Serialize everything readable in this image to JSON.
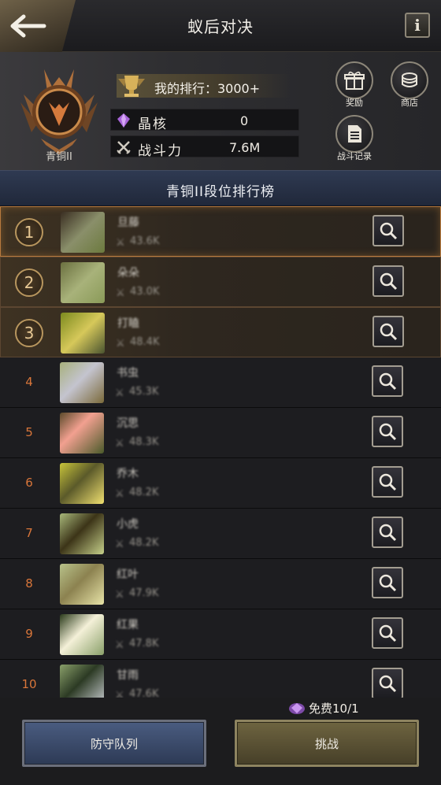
{
  "header": {
    "title": "蚁后对决",
    "info_label": "i"
  },
  "profile": {
    "rank_name": "青铜II",
    "my_rank_label": "我的排行：3000+",
    "crystal_label": "晶核",
    "crystal_value": "0",
    "power_label": "战斗力",
    "power_value": "7.6M",
    "reward_label": "奖励",
    "shop_label": "商店",
    "battle_log_label": "战斗记录"
  },
  "board": {
    "title": "青铜II段位排行榜"
  },
  "rows": [
    {
      "rank": "1",
      "name": "旦藤",
      "power": "43.6K"
    },
    {
      "rank": "2",
      "name": "朵朵",
      "power": "43.0K"
    },
    {
      "rank": "3",
      "name": "打瞌",
      "power": "48.4K"
    },
    {
      "rank": "4",
      "name": "书虫",
      "power": "45.3K"
    },
    {
      "rank": "5",
      "name": "沉思",
      "power": "48.3K"
    },
    {
      "rank": "6",
      "name": "乔木",
      "power": "48.2K"
    },
    {
      "rank": "7",
      "name": "小虎",
      "power": "48.2K"
    },
    {
      "rank": "8",
      "name": "红叶",
      "power": "47.9K"
    },
    {
      "rank": "9",
      "name": "红果",
      "power": "47.8K"
    },
    {
      "rank": "10",
      "name": "甘雨",
      "power": "47.6K"
    }
  ],
  "bottom": {
    "free_text": "免费10/1",
    "defense_label": "防守队列",
    "challenge_label": "挑战"
  },
  "colors": {
    "rank_number": "#d9763a",
    "accent_gold": "#b8965e",
    "board_header": "#2f3a52"
  },
  "icons": {
    "back": "arrow-left-icon",
    "info": "info-icon",
    "trophy": "trophy-icon",
    "crystal": "crystal-icon",
    "power": "crossed-swords-icon",
    "reward": "gift-icon",
    "shop": "coins-icon",
    "battle_log": "document-icon",
    "view": "magnifier-icon"
  }
}
